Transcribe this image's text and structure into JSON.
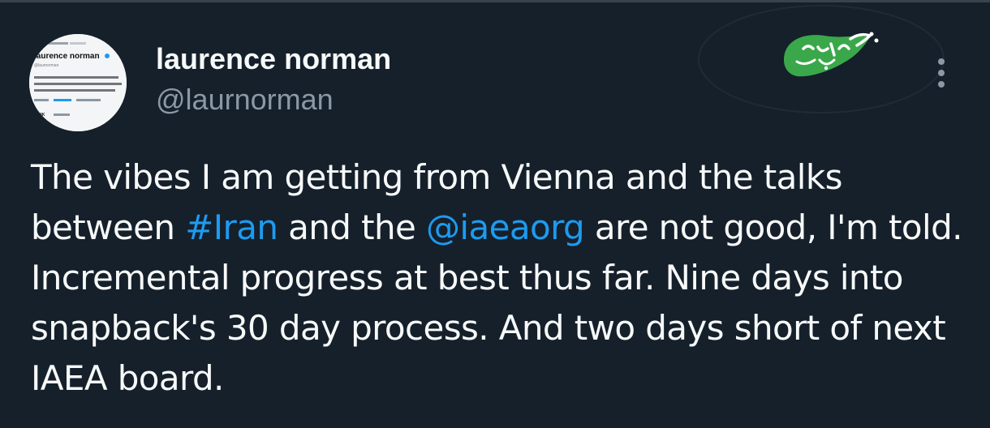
{
  "author": {
    "display_name": "laurence norman",
    "handle": "@laurnorman",
    "avatar_preview": {
      "name": "laurence norman",
      "handle": "@laurnorman",
      "bio": "In Europe for The Wall Street Journal. nuclear, EU, European foreign policy that comes my way. My RT; someone",
      "followers": "29.8K"
    }
  },
  "watermark": {
    "text": "خبرفوری"
  },
  "tweet": {
    "segments": [
      {
        "text": "The vibes I am getting from Vienna and the talks between ",
        "type": "text"
      },
      {
        "text": "#Iran",
        "type": "hashtag"
      },
      {
        "text": " and the ",
        "type": "text"
      },
      {
        "text": "@iaeaorg",
        "type": "mention"
      },
      {
        "text": " are not good, I'm told. Incremental progress at best thus far. Nine days into snapback's 30 day process. And two days short of next IAEA board.",
        "type": "text"
      }
    ]
  },
  "colors": {
    "background": "#15202b",
    "text": "#f7f9f9",
    "muted": "#8b98a5",
    "link": "#1d9bf0",
    "watermark_green": "#3aa84a"
  },
  "icons": {
    "more": "more-vertical-icon",
    "verified": "verified-badge-icon"
  }
}
